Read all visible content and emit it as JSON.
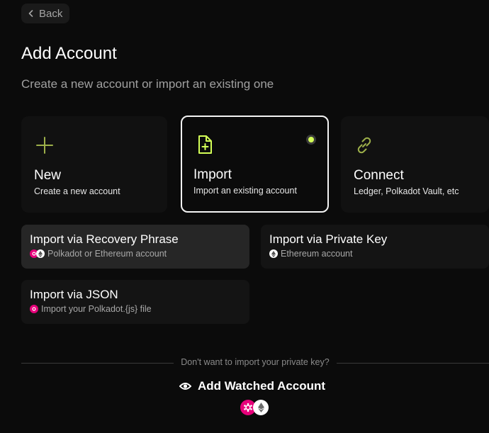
{
  "nav": {
    "back_label": "Back"
  },
  "header": {
    "title": "Add Account",
    "subtitle": "Create a new account or import an existing one"
  },
  "cards": [
    {
      "title": "New",
      "subtitle": "Create a new account",
      "icon": "plus-icon"
    },
    {
      "title": "Import",
      "subtitle": "Import an existing account",
      "icon": "file-plus-icon",
      "selected": true
    },
    {
      "title": "Connect",
      "subtitle": "Ledger, Polkadot Vault, etc",
      "icon": "link-icon"
    }
  ],
  "import_options": [
    {
      "title": "Import via Recovery Phrase",
      "subtitle": "Polkadot or Ethereum account",
      "chains": [
        "polkadot",
        "ethereum"
      ],
      "active": true
    },
    {
      "title": "Import via Private Key",
      "subtitle": "Ethereum account",
      "chains": [
        "ethereum"
      ]
    },
    {
      "title": "Import via JSON",
      "subtitle": "Import your Polkadot.{js} file",
      "chains": [
        "polkadot"
      ]
    }
  ],
  "watched": {
    "divider_text": "Don't want to import your private key?",
    "label": "Add Watched Account",
    "icon": "eye-icon",
    "chains": [
      "polkadot",
      "ethereum"
    ]
  },
  "colors": {
    "background": "#0b0b0b",
    "accent": "#d3ff57",
    "icon_green": "#a5c24a",
    "polkadot_pink": "#e6007a"
  }
}
